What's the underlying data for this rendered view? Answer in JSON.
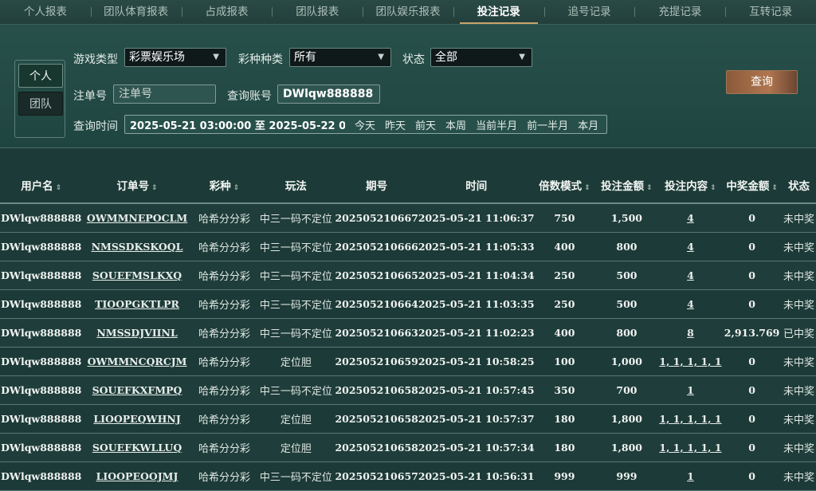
{
  "tabs": [
    "个人报表",
    "团队体育报表",
    "占成报表",
    "团队报表",
    "团队娱乐报表",
    "投注记录",
    "追号记录",
    "充提记录",
    "互转记录"
  ],
  "active_tab": 5,
  "scope": {
    "personal": "个人",
    "team": "团队"
  },
  "filters": {
    "game_type_label": "游戏类型",
    "game_type_value": "彩票娱乐场",
    "lottery_label": "彩种种类",
    "lottery_value": "所有",
    "status_label": "状态",
    "status_value": "全部",
    "order_label": "注单号",
    "order_placeholder": "注单号",
    "account_label": "查询账号",
    "account_value": "DWlqw888888",
    "time_label": "查询时间",
    "time_range": "2025-05-21 03:00:00 至 2025-05-22 03:00:0",
    "quick": [
      "今天",
      "昨天",
      "前天",
      "本周",
      "当前半月",
      "前一半月",
      "本月"
    ],
    "query_button": "查询"
  },
  "columns": [
    "用户名",
    "订单号",
    "彩种",
    "玩法",
    "期号",
    "时间",
    "倍数模式",
    "投注金额",
    "投注内容",
    "中奖金额",
    "状态"
  ],
  "rows": [
    {
      "user": "DWlqw888888",
      "order": "OWMMNEPOCLM",
      "lottery": "哈希分分彩",
      "play": "中三一码不定位",
      "issue": "202505210667",
      "time": "2025-05-21 11:06:37",
      "multi": "750",
      "amount": "1,500",
      "content": "4",
      "win": "0",
      "status": "未中奖"
    },
    {
      "user": "DWlqw888888",
      "order": "NMSSDKSKOQL",
      "lottery": "哈希分分彩",
      "play": "中三一码不定位",
      "issue": "202505210666",
      "time": "2025-05-21 11:05:33",
      "multi": "400",
      "amount": "800",
      "content": "4",
      "win": "0",
      "status": "未中奖"
    },
    {
      "user": "DWlqw888888",
      "order": "SOUEFMSLKXQ",
      "lottery": "哈希分分彩",
      "play": "中三一码不定位",
      "issue": "202505210665",
      "time": "2025-05-21 11:04:34",
      "multi": "250",
      "amount": "500",
      "content": "4",
      "win": "0",
      "status": "未中奖"
    },
    {
      "user": "DWlqw888888",
      "order": "TIOOPGKTLPR",
      "lottery": "哈希分分彩",
      "play": "中三一码不定位",
      "issue": "202505210664",
      "time": "2025-05-21 11:03:35",
      "multi": "250",
      "amount": "500",
      "content": "4",
      "win": "0",
      "status": "未中奖"
    },
    {
      "user": "DWlqw888888",
      "order": "NMSSDJVIINL",
      "lottery": "哈希分分彩",
      "play": "中三一码不定位",
      "issue": "202505210663",
      "time": "2025-05-21 11:02:23",
      "multi": "400",
      "amount": "800",
      "content": "8",
      "win": "2,913.769",
      "status": "已中奖"
    },
    {
      "user": "DWlqw888888",
      "order": "OWMMNCQRCJM",
      "lottery": "哈希分分彩",
      "play": "定位胆",
      "issue": "202505210659",
      "time": "2025-05-21 10:58:25",
      "multi": "100",
      "amount": "1,000",
      "content": "1, 1, 1, 1, 1",
      "win": "0",
      "status": "未中奖"
    },
    {
      "user": "DWlqw888888",
      "order": "SOUEFKXFMPQ",
      "lottery": "哈希分分彩",
      "play": "中三一码不定位",
      "issue": "202505210658",
      "time": "2025-05-21 10:57:45",
      "multi": "350",
      "amount": "700",
      "content": "1",
      "win": "0",
      "status": "未中奖"
    },
    {
      "user": "DWlqw888888",
      "order": "LIOOPEQWHNJ",
      "lottery": "哈希分分彩",
      "play": "定位胆",
      "issue": "202505210658",
      "time": "2025-05-21 10:57:37",
      "multi": "180",
      "amount": "1,800",
      "content": "1, 1, 1, 1, 1",
      "win": "0",
      "status": "未中奖"
    },
    {
      "user": "DWlqw888888",
      "order": "SOUEFKWLLUQ",
      "lottery": "哈希分分彩",
      "play": "定位胆",
      "issue": "202505210658",
      "time": "2025-05-21 10:57:34",
      "multi": "180",
      "amount": "1,800",
      "content": "1, 1, 1, 1, 1",
      "win": "0",
      "status": "未中奖"
    },
    {
      "user": "DWlqw888888",
      "order": "LIOOPEOOJMJ",
      "lottery": "哈希分分彩",
      "play": "中三一码不定位",
      "issue": "202505210657",
      "time": "2025-05-21 10:56:31",
      "multi": "999",
      "amount": "999",
      "content": "1",
      "win": "0",
      "status": "未中奖"
    }
  ]
}
